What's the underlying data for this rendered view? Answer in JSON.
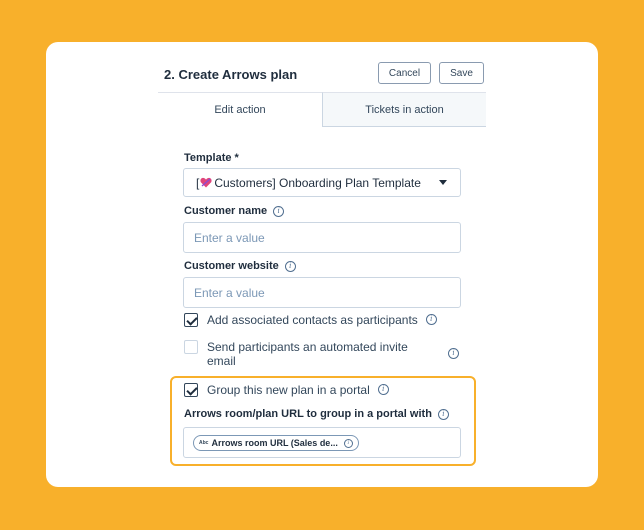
{
  "header": {
    "title": "2. Create Arrows plan",
    "cancel_label": "Cancel",
    "save_label": "Save"
  },
  "tabs": [
    {
      "label": "Edit action",
      "active": true
    },
    {
      "label": "Tickets in action",
      "active": false
    }
  ],
  "form": {
    "template": {
      "label": "Template *",
      "value_prefix": "[",
      "value": " Customers] Onboarding Plan Template"
    },
    "customer_name": {
      "label": "Customer name",
      "placeholder": "Enter a value"
    },
    "customer_website": {
      "label": "Customer website",
      "placeholder": "Enter a value"
    },
    "checkboxes": [
      {
        "label": "Add associated contacts as participants",
        "checked": true
      },
      {
        "label": "Send participants an automated invite email",
        "checked": false
      },
      {
        "label": "Group this new plan in a portal",
        "checked": true
      }
    ],
    "portal_url": {
      "label": "Arrows room/plan URL to group in a portal with",
      "token_type": "Abc",
      "token_label": "Arrows room URL (Sales de..."
    }
  },
  "colors": {
    "background": "#F8B02B",
    "highlight_border": "#F8B02B",
    "heart": "#e0457b"
  }
}
